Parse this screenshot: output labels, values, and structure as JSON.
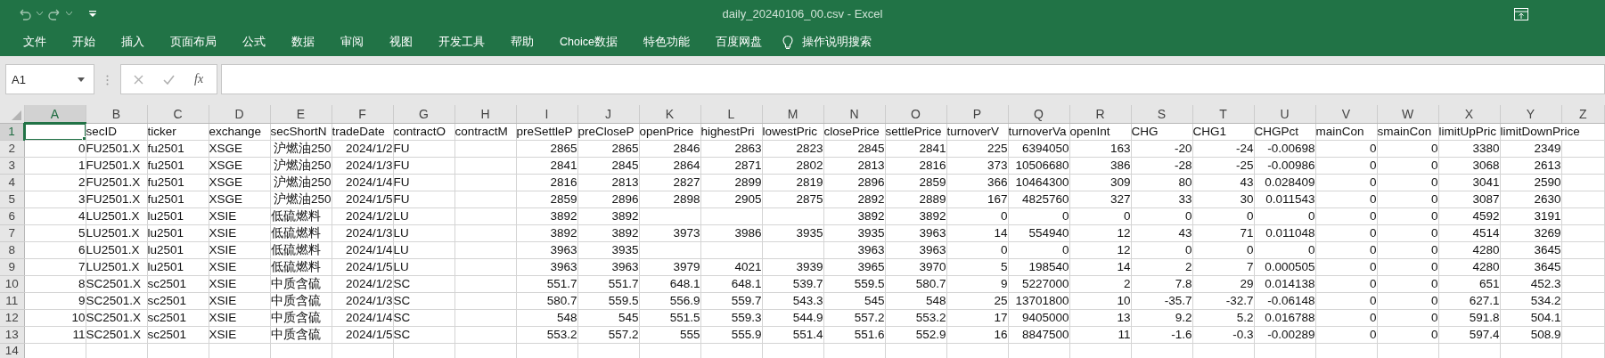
{
  "window": {
    "title": "daily_20240106_00.csv - Excel"
  },
  "ribbon_tabs": [
    "文件",
    "开始",
    "插入",
    "页面布局",
    "公式",
    "数据",
    "审阅",
    "视图",
    "开发工具",
    "帮助",
    "Choice数据",
    "特色功能",
    "百度网盘"
  ],
  "tell_me": "操作说明搜索",
  "formula_bar": {
    "name_box": "A1",
    "function_label": "fx"
  },
  "columns": [
    {
      "letter": "A",
      "selected": true
    },
    {
      "letter": "B",
      "selected": false
    },
    {
      "letter": "C",
      "selected": false
    },
    {
      "letter": "D",
      "selected": false
    },
    {
      "letter": "E",
      "selected": false
    },
    {
      "letter": "F",
      "selected": false
    },
    {
      "letter": "G",
      "selected": false
    },
    {
      "letter": "H",
      "selected": false
    },
    {
      "letter": "I",
      "selected": false
    },
    {
      "letter": "J",
      "selected": false
    },
    {
      "letter": "K",
      "selected": false
    },
    {
      "letter": "L",
      "selected": false
    },
    {
      "letter": "M",
      "selected": false
    },
    {
      "letter": "N",
      "selected": false
    },
    {
      "letter": "O",
      "selected": false
    },
    {
      "letter": "P",
      "selected": false
    },
    {
      "letter": "Q",
      "selected": false
    },
    {
      "letter": "R",
      "selected": false
    },
    {
      "letter": "S",
      "selected": false
    },
    {
      "letter": "T",
      "selected": false
    },
    {
      "letter": "U",
      "selected": false
    },
    {
      "letter": "V",
      "selected": false
    },
    {
      "letter": "W",
      "selected": false
    },
    {
      "letter": "X",
      "selected": false
    },
    {
      "letter": "Y",
      "selected": false
    },
    {
      "letter": "Z",
      "selected": false
    }
  ],
  "rows": [
    {
      "number": "1",
      "selected": true,
      "cells": [
        null,
        "secID",
        "ticker",
        "exchange",
        "secShortN",
        "tradeDate",
        "contractO",
        "contractM",
        "preSettleP",
        "preCloseP",
        "openPrice",
        "highestPri",
        "lowestPric",
        "closePrice",
        "settlePrice",
        "turnoverV",
        "turnoverVa",
        "openInt",
        "CHG",
        "CHG1",
        "CHGPct",
        "mainCon",
        "smainCon",
        "limitUpPric",
        "limitDownPrice"
      ]
    },
    {
      "number": "2",
      "selected": false,
      "cells": [
        "0",
        "FU2501.X",
        "fu2501",
        "XSGE",
        "沪燃油250",
        "2024/1/2",
        "FU",
        null,
        "2865",
        "2865",
        "2846",
        "2863",
        "2823",
        "2845",
        "2841",
        "225",
        "6394050",
        "163",
        "-20",
        "-24",
        "-0.00698",
        "0",
        "0",
        "3380",
        "2349"
      ]
    },
    {
      "number": "3",
      "selected": false,
      "cells": [
        "1",
        "FU2501.X",
        "fu2501",
        "XSGE",
        "沪燃油250",
        "2024/1/3",
        "FU",
        null,
        "2841",
        "2845",
        "2864",
        "2871",
        "2802",
        "2813",
        "2816",
        "373",
        "10506680",
        "386",
        "-28",
        "-25",
        "-0.00986",
        "0",
        "0",
        "3068",
        "2613"
      ]
    },
    {
      "number": "4",
      "selected": false,
      "cells": [
        "2",
        "FU2501.X",
        "fu2501",
        "XSGE",
        "沪燃油250",
        "2024/1/4",
        "FU",
        null,
        "2816",
        "2813",
        "2827",
        "2899",
        "2819",
        "2896",
        "2859",
        "366",
        "10464300",
        "309",
        "80",
        "43",
        "0.028409",
        "0",
        "0",
        "3041",
        "2590"
      ]
    },
    {
      "number": "5",
      "selected": false,
      "cells": [
        "3",
        "FU2501.X",
        "fu2501",
        "XSGE",
        "沪燃油250",
        "2024/1/5",
        "FU",
        null,
        "2859",
        "2896",
        "2898",
        "2905",
        "2875",
        "2892",
        "2889",
        "167",
        "4825760",
        "327",
        "33",
        "30",
        "0.011543",
        "0",
        "0",
        "3087",
        "2630"
      ]
    },
    {
      "number": "6",
      "selected": false,
      "cells": [
        "4",
        "LU2501.X",
        "lu2501",
        "XSIE",
        "低硫燃料",
        "2024/1/2",
        "LU",
        null,
        "3892",
        "3892",
        null,
        null,
        null,
        "3892",
        "3892",
        "0",
        "0",
        "0",
        "0",
        "0",
        "0",
        "0",
        "0",
        "4592",
        "3191"
      ]
    },
    {
      "number": "7",
      "selected": false,
      "cells": [
        "5",
        "LU2501.X",
        "lu2501",
        "XSIE",
        "低硫燃料",
        "2024/1/3",
        "LU",
        null,
        "3892",
        "3892",
        "3973",
        "3986",
        "3935",
        "3935",
        "3963",
        "14",
        "554940",
        "12",
        "43",
        "71",
        "0.011048",
        "0",
        "0",
        "4514",
        "3269"
      ]
    },
    {
      "number": "8",
      "selected": false,
      "cells": [
        "6",
        "LU2501.X",
        "lu2501",
        "XSIE",
        "低硫燃料",
        "2024/1/4",
        "LU",
        null,
        "3963",
        "3935",
        null,
        null,
        null,
        "3963",
        "3963",
        "0",
        "0",
        "12",
        "0",
        "0",
        "0",
        "0",
        "0",
        "4280",
        "3645"
      ]
    },
    {
      "number": "9",
      "selected": false,
      "cells": [
        "7",
        "LU2501.X",
        "lu2501",
        "XSIE",
        "低硫燃料",
        "2024/1/5",
        "LU",
        null,
        "3963",
        "3963",
        "3979",
        "4021",
        "3939",
        "3965",
        "3970",
        "5",
        "198540",
        "14",
        "2",
        "7",
        "0.000505",
        "0",
        "0",
        "4280",
        "3645"
      ]
    },
    {
      "number": "10",
      "selected": false,
      "cells": [
        "8",
        "SC2501.X",
        "sc2501",
        "XSIE",
        "中质含硫",
        "2024/1/2",
        "SC",
        null,
        "551.7",
        "551.7",
        "648.1",
        "648.1",
        "539.7",
        "559.5",
        "580.7",
        "9",
        "5227000",
        "2",
        "7.8",
        "29",
        "0.014138",
        "0",
        "0",
        "651",
        "452.3"
      ]
    },
    {
      "number": "11",
      "selected": false,
      "cells": [
        "9",
        "SC2501.X",
        "sc2501",
        "XSIE",
        "中质含硫",
        "2024/1/3",
        "SC",
        null,
        "580.7",
        "559.5",
        "556.9",
        "559.7",
        "543.3",
        "545",
        "548",
        "25",
        "13701800",
        "10",
        "-35.7",
        "-32.7",
        "-0.06148",
        "0",
        "0",
        "627.1",
        "534.2"
      ]
    },
    {
      "number": "12",
      "selected": false,
      "cells": [
        "10",
        "SC2501.X",
        "sc2501",
        "XSIE",
        "中质含硫",
        "2024/1/4",
        "SC",
        null,
        "548",
        "545",
        "551.5",
        "559.3",
        "544.9",
        "557.2",
        "553.2",
        "17",
        "9405000",
        "13",
        "9.2",
        "5.2",
        "0.016788",
        "0",
        "0",
        "591.8",
        "504.1"
      ]
    },
    {
      "number": "13",
      "selected": false,
      "cells": [
        "11",
        "SC2501.X",
        "sc2501",
        "XSIE",
        "中质含硫",
        "2024/1/5",
        "SC",
        null,
        "553.2",
        "557.2",
        "555",
        "555.9",
        "551.4",
        "551.6",
        "552.9",
        "16",
        "8847500",
        "11",
        "-1.6",
        "-0.3",
        "-0.00289",
        "0",
        "0",
        "597.4",
        "508.9"
      ]
    },
    {
      "number": "14",
      "selected": false
    }
  ]
}
